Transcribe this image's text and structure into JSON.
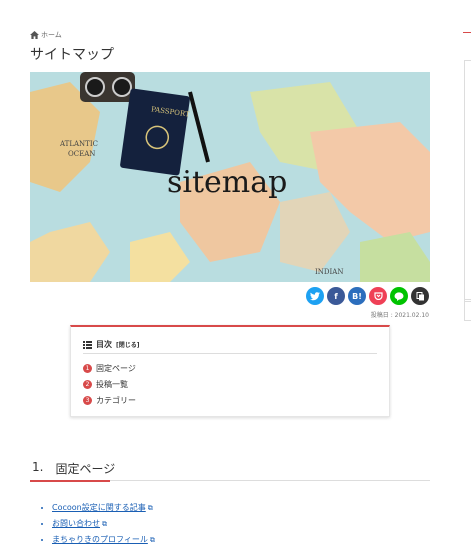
{
  "breadcrumb": {
    "home_label": "ホーム"
  },
  "page_title": "サイトマップ",
  "hero": {
    "caption": "sitemap",
    "passport_label": "PASSPORT",
    "map_labels": [
      "ATLANTIC",
      "OCEAN",
      "INDIAN"
    ]
  },
  "share": {
    "buttons": [
      {
        "name": "twitter-share-button",
        "label": "",
        "color": "#1da1f2"
      },
      {
        "name": "facebook-share-button",
        "label": "f",
        "color": "#3b5998"
      },
      {
        "name": "hatena-share-button",
        "label": "B!",
        "color": "#2c6ebd"
      },
      {
        "name": "pocket-share-button",
        "label": "",
        "color": "#ef4056"
      },
      {
        "name": "line-share-button",
        "label": "",
        "color": "#00c300"
      },
      {
        "name": "copy-share-button",
        "label": "",
        "color": "#333333"
      }
    ]
  },
  "post_date": "投稿日 : 2021.02.10",
  "toc": {
    "title": "目次",
    "toggle": "[閉じる]",
    "items": [
      {
        "num": "1",
        "label": "固定ページ"
      },
      {
        "num": "2",
        "label": "投稿一覧"
      },
      {
        "num": "3",
        "label": "カテゴリー"
      }
    ]
  },
  "section": {
    "number": "1.",
    "title": "固定ページ"
  },
  "links": [
    "Cocoon設定に関する記事",
    "お問い合わせ",
    "まちゃりきのプロフィール"
  ],
  "colors": {
    "accent": "#d84a4a",
    "link": "#1a5fb4"
  }
}
